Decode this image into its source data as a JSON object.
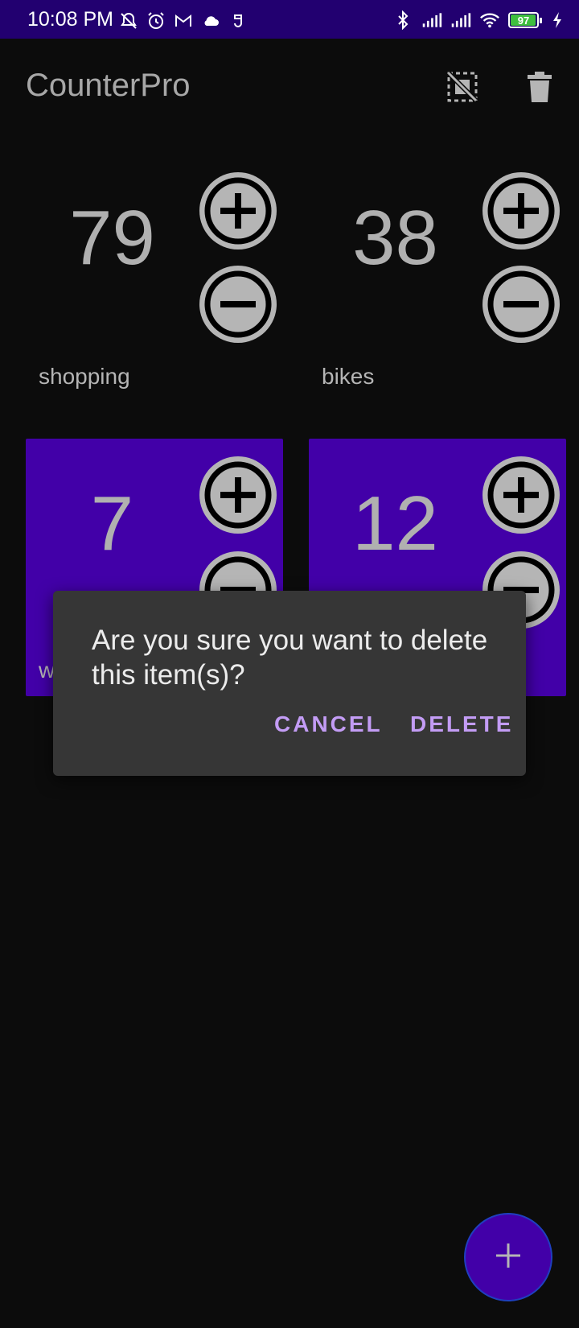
{
  "status_bar": {
    "time": "10:08 PM",
    "left_icons": [
      "bell-off-icon",
      "alarm-icon",
      "gmail-icon",
      "cloud-icon",
      "app-notification-icon"
    ],
    "right_icons": [
      "bluetooth-icon",
      "signal-icon",
      "signal-icon",
      "wifi-icon"
    ],
    "battery_level": "97",
    "charging": true,
    "background": "#220070"
  },
  "app_bar": {
    "title": "CounterPro",
    "actions": [
      "deselect-icon",
      "trash-icon"
    ]
  },
  "counters": [
    {
      "value": "79",
      "name": "shopping",
      "highlighted": false
    },
    {
      "value": "38",
      "name": "bikes",
      "highlighted": false
    },
    {
      "value": "7",
      "name": "w",
      "highlighted": true
    },
    {
      "value": "12",
      "name": "",
      "highlighted": true
    }
  ],
  "dialog": {
    "message": "Are you sure you want to delete this item(s)?",
    "cancel_label": "CANCEL",
    "delete_label": "DELETE"
  },
  "fab": {
    "label": "+",
    "icon": "plus-icon"
  },
  "colors": {
    "accent": "#4200a8",
    "dialog_button": "#c39cf5",
    "background": "#0c0c0c"
  }
}
